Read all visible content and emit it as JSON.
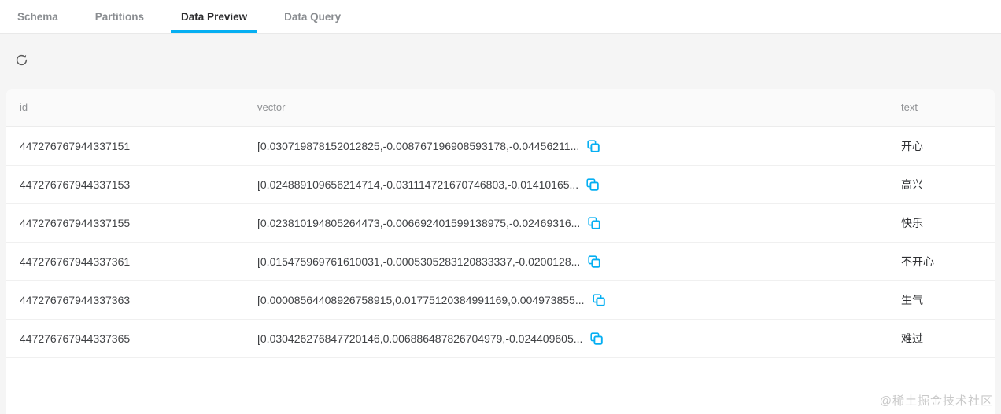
{
  "tabs": [
    {
      "label": "Schema",
      "active": false
    },
    {
      "label": "Partitions",
      "active": false
    },
    {
      "label": "Data Preview",
      "active": true
    },
    {
      "label": "Data Query",
      "active": false
    }
  ],
  "toolbar": {
    "refresh_icon": "refresh-circular-arrow"
  },
  "table": {
    "columns": [
      "id",
      "vector",
      "text"
    ],
    "copy_icon": "copy-overlapping-squares",
    "rows": [
      {
        "id": "447276767944337151",
        "vector": "[0.030719878152012825,-0.008767196908593178,-0.04456211...",
        "text": "开心"
      },
      {
        "id": "447276767944337153",
        "vector": "[0.024889109656214714,-0.031114721670746803,-0.01410165...",
        "text": "高兴"
      },
      {
        "id": "447276767944337155",
        "vector": "[0.023810194805264473,-0.006692401599138975,-0.02469316...",
        "text": "快乐"
      },
      {
        "id": "447276767944337361",
        "vector": "[0.015475969761610031,-0.0005305283120833337,-0.0200128...",
        "text": "不开心"
      },
      {
        "id": "447276767944337363",
        "vector": "[0.00008564408926758915,0.01775120384991169,0.004973855...",
        "text": "生气"
      },
      {
        "id": "447276767944337365",
        "vector": "[0.030426276847720146,0.006886487826704979,-0.024409605...",
        "text": "难过"
      }
    ]
  },
  "watermark": "@稀土掘金技术社区",
  "colors": {
    "accent": "#06aff2",
    "icon_gray": "#5b5b5b",
    "watermark": "#c9c9c9"
  }
}
